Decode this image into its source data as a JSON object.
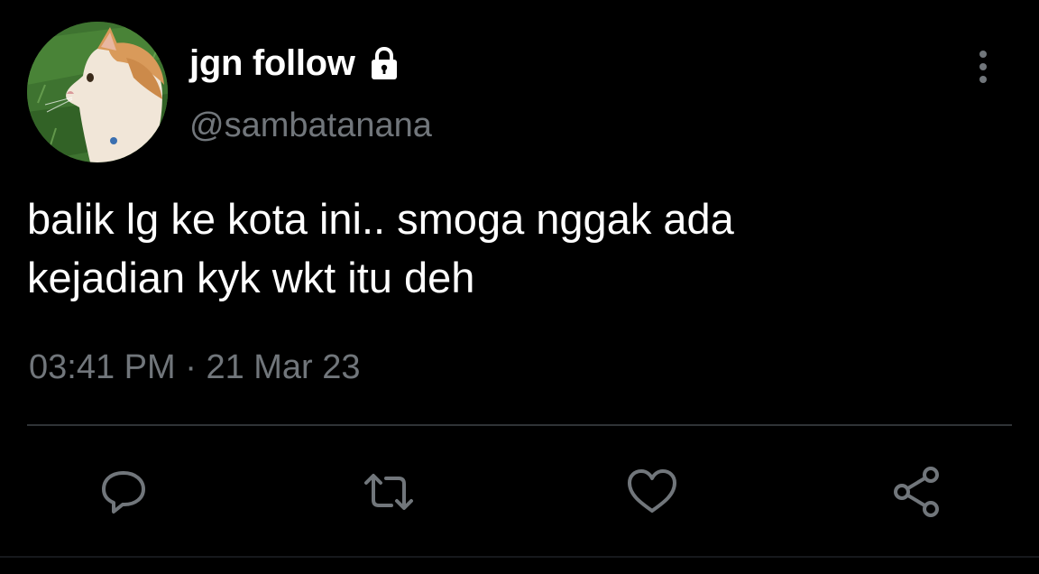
{
  "author": {
    "display_name": "jgn follow",
    "handle": "@sambatanana",
    "protected": true,
    "avatar": "cat-avatar"
  },
  "tweet": {
    "text_lines": [
      "balik lg ke kota ini.. smoga nggak ada",
      "kejadian kyk wkt itu deh"
    ],
    "time": "03:41 PM",
    "separator": "·",
    "date": "21 Mar 23"
  },
  "actions": {
    "reply": "reply-icon",
    "retweet": "retweet-icon",
    "like": "heart-icon",
    "share": "share-icon"
  },
  "colors": {
    "background": "#000000",
    "primary_text": "#ffffff",
    "secondary_text": "#71767b",
    "divider": "#2f3336"
  }
}
